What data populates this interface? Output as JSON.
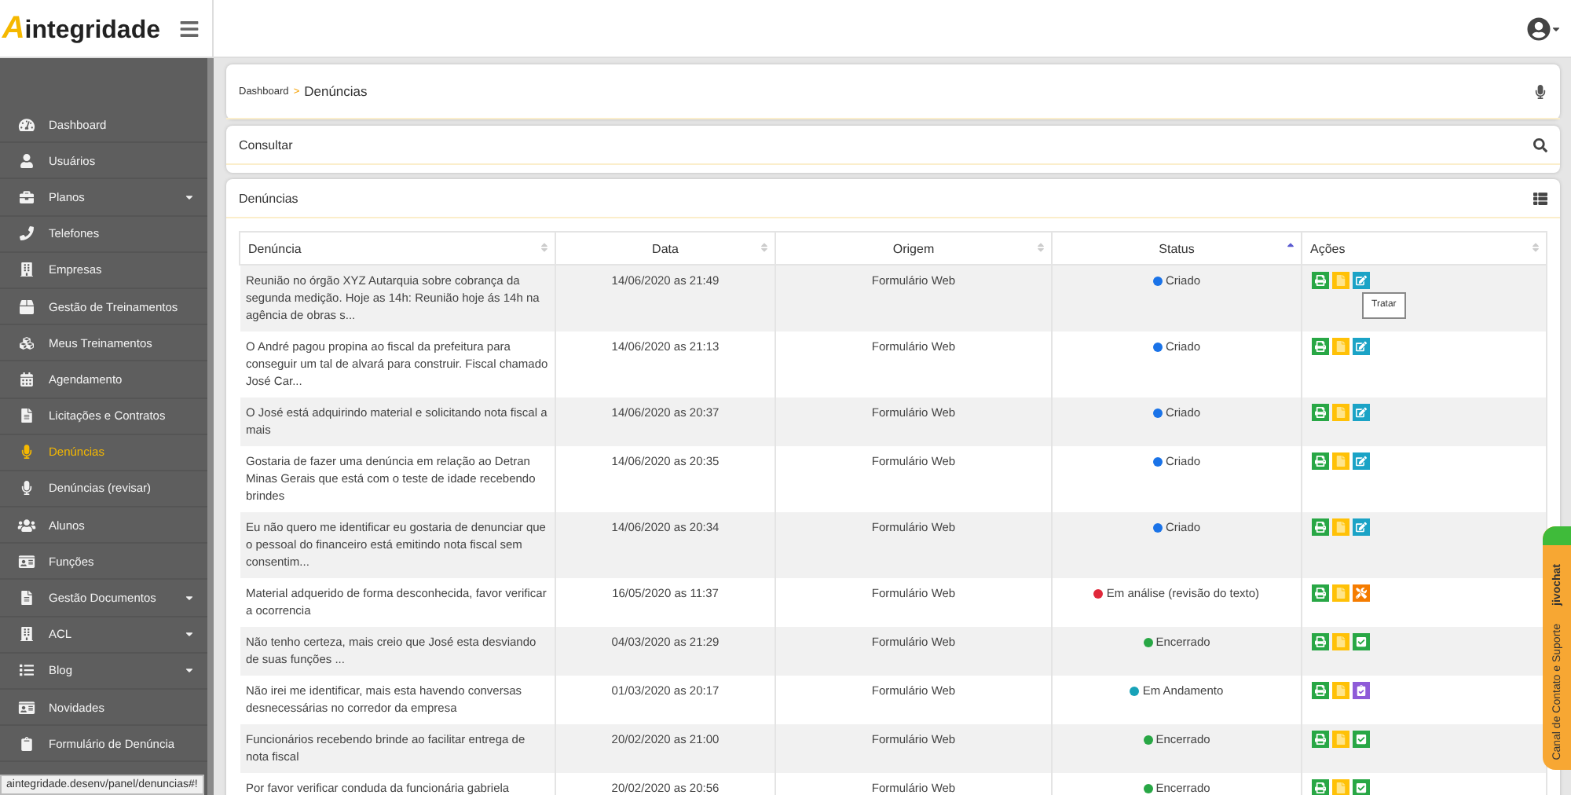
{
  "header": {
    "logo_letter": "A",
    "logo_text": "integridade"
  },
  "sidebar": {
    "items": [
      {
        "label": "Dashboard",
        "selected": false,
        "has_submenu": false
      },
      {
        "label": "Usuários",
        "selected": false,
        "has_submenu": false
      },
      {
        "label": "Planos",
        "selected": false,
        "has_submenu": true
      },
      {
        "label": "Telefones",
        "selected": false,
        "has_submenu": false
      },
      {
        "label": "Empresas",
        "selected": false,
        "has_submenu": false
      },
      {
        "label": "Gestão de Treinamentos",
        "selected": false,
        "has_submenu": false
      },
      {
        "label": "Meus Treinamentos",
        "selected": false,
        "has_submenu": false
      },
      {
        "label": "Agendamento",
        "selected": false,
        "has_submenu": false
      },
      {
        "label": "Licitações e Contratos",
        "selected": false,
        "has_submenu": false
      },
      {
        "label": "Denúncias",
        "selected": true,
        "has_submenu": false
      },
      {
        "label": "Denúncias (revisar)",
        "selected": false,
        "has_submenu": false
      },
      {
        "label": "Alunos",
        "selected": false,
        "has_submenu": false
      },
      {
        "label": "Funções",
        "selected": false,
        "has_submenu": false
      },
      {
        "label": "Gestão Documentos",
        "selected": false,
        "has_submenu": true
      },
      {
        "label": "ACL",
        "selected": false,
        "has_submenu": true
      },
      {
        "label": "Blog",
        "selected": false,
        "has_submenu": true
      },
      {
        "label": "Novidades",
        "selected": false,
        "has_submenu": false
      },
      {
        "label": "Formulário de Denúncia",
        "selected": false,
        "has_submenu": false
      }
    ],
    "status_url": "aintegridade.desenv/panel/denuncias#!"
  },
  "breadcrumb": {
    "parent": "Dashboard",
    "separator": ">",
    "current": "Denúncias"
  },
  "search_panel": {
    "title": "Consultar"
  },
  "list_panel": {
    "title": "Denúncias"
  },
  "table": {
    "columns": [
      {
        "label": "Denúncia",
        "sorted": false
      },
      {
        "label": "Data",
        "sorted": false
      },
      {
        "label": "Origem",
        "sorted": false
      },
      {
        "label": "Status",
        "sorted": true
      },
      {
        "label": "Ações",
        "sorted": false
      }
    ],
    "rows": [
      {
        "text": "Reunião no órgão XYZ Autarquia sobre cobrança da segunda medição. Hoje as 14h: Reunião hoje ás 14h na agência de obras s...",
        "date": "14/06/2020 as 21:49",
        "origin": "Formulário Web",
        "status": "Criado",
        "color": "#1a73e8",
        "kind": "edit",
        "tooltip": "Tratar"
      },
      {
        "text": "O André pagou propina ao fiscal da prefeitura para conseguir um tal de alvará para construir. Fiscal chamado José Car...",
        "date": "14/06/2020 as 21:13",
        "origin": "Formulário Web",
        "status": "Criado",
        "color": "#1a73e8",
        "kind": "edit"
      },
      {
        "text": "O José está adquirindo material e solicitando nota fiscal a mais",
        "date": "14/06/2020 as 20:37",
        "origin": "Formulário Web",
        "status": "Criado",
        "color": "#1a73e8",
        "kind": "edit"
      },
      {
        "text": "Gostaria de fazer uma denúncia em relação ao Detran Minas Gerais que está com o teste de idade recebendo brindes",
        "date": "14/06/2020 as 20:35",
        "origin": "Formulário Web",
        "status": "Criado",
        "color": "#1a73e8",
        "kind": "edit"
      },
      {
        "text": "Eu não quero me identificar eu gostaria de denunciar que o pessoal do financeiro está emitindo nota fiscal sem consentim...",
        "date": "14/06/2020 as 20:34",
        "origin": "Formulário Web",
        "status": "Criado",
        "color": "#1a73e8",
        "kind": "edit"
      },
      {
        "text": "Material adquerido de forma desconhecida, favor verificar a ocorrencia",
        "date": "16/05/2020 as 11:37",
        "origin": "Formulário Web",
        "status": "Em análise (revisão do texto)",
        "color": "#e0283a",
        "kind": "tools"
      },
      {
        "text": "Não tenho certeza, mais creio que José esta desviando de suas funções ...",
        "date": "04/03/2020 as 21:29",
        "origin": "Formulário Web",
        "status": "Encerrado",
        "color": "#28a745",
        "kind": "check"
      },
      {
        "text": "Não irei me identificar, mais esta havendo conversas desnecessárias no corredor da empresa",
        "date": "01/03/2020 as 20:17",
        "origin": "Formulário Web",
        "status": "Em Andamento",
        "color": "#17a2b8",
        "kind": "clipboard"
      },
      {
        "text": "Funcionários recebendo brinde ao facilitar entrega de nota fiscal",
        "date": "20/02/2020 as 21:00",
        "origin": "Formulário Web",
        "status": "Encerrado",
        "color": "#28a745",
        "kind": "check"
      },
      {
        "text": "Por favor verificar conduda da funcionária gabriela",
        "date": "20/02/2020 as 20:56",
        "origin": "Formulário Web",
        "status": "Encerrado",
        "color": "#28a745",
        "kind": "check"
      }
    ]
  },
  "chat_tab": {
    "brand": "jivochat",
    "label": "Canal de Contato e Suporte"
  }
}
